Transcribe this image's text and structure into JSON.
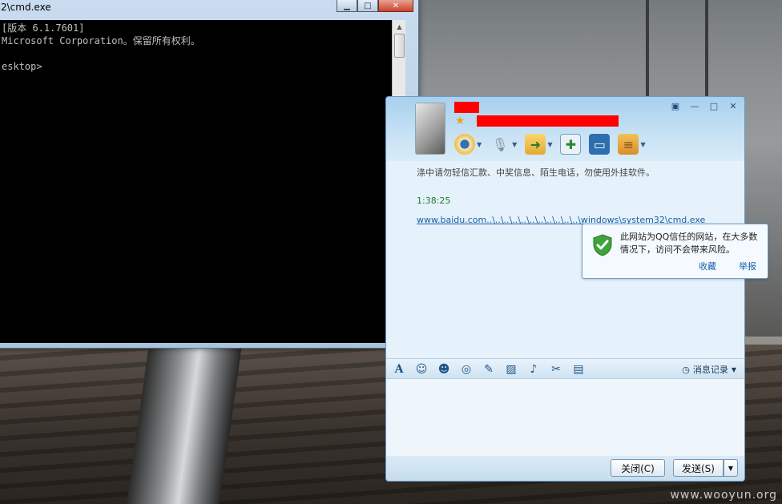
{
  "cmd": {
    "title": "2\\cmd.exe",
    "lines": [
      "[版本 6.1.7601]",
      "Microsoft Corporation。保留所有权利。",
      "",
      "esktop>"
    ]
  },
  "qq": {
    "notice": "涤中请勿轻信汇款、中奖信息、陌生电话，勿使用外挂软件。",
    "message_time": "1:38:25",
    "message_link": "www.baidu.com..\\..\\..\\..\\..\\..\\..\\..\\..\\..\\..\\windows\\system32\\cmd.exe",
    "tooltip": {
      "text": "此网站为QQ信任的网站，在大多数情况下，访问不会带来风险。",
      "favorite": "收藏",
      "report": "举报"
    },
    "history_label": "消息记录",
    "close_button": "关闭(C)",
    "send_button": "发送(S)"
  },
  "watermark": "www.wooyun.org",
  "colors": {
    "redaction": "#ff0000",
    "link": "#1b5fa8",
    "time": "#1a7d2d"
  }
}
